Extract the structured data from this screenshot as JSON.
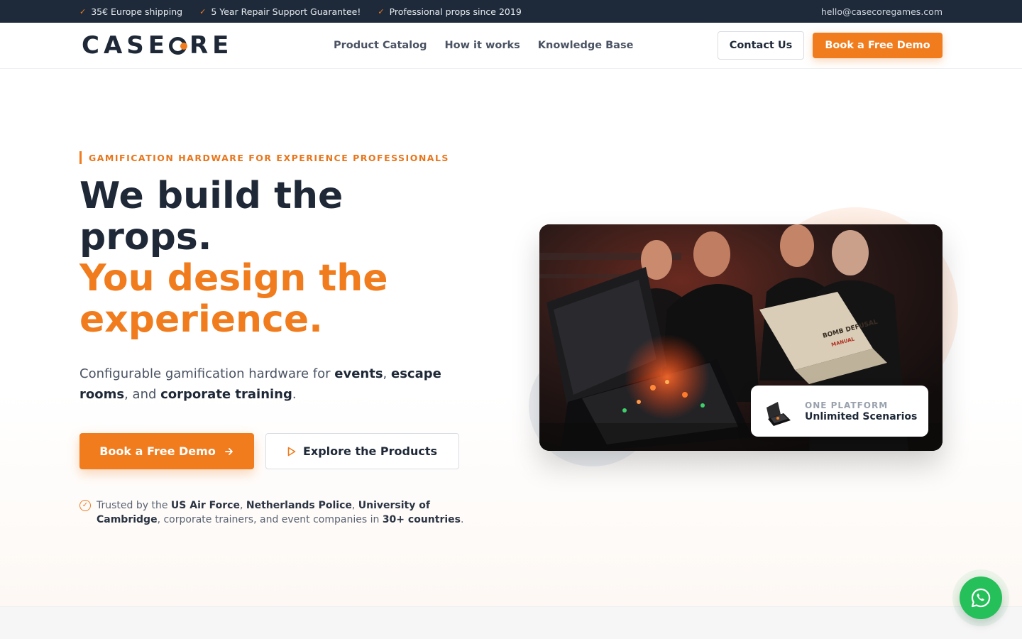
{
  "topbar": {
    "perks": [
      {
        "icon": "check-icon",
        "label": "35€ Europe shipping"
      },
      {
        "icon": "check-icon",
        "label": "5 Year Repair Support Guarantee!"
      },
      {
        "icon": "check-icon",
        "label": "Professional props since 2019"
      }
    ],
    "email": "hello@casecoregames.com"
  },
  "header": {
    "logo": {
      "before": "CASE",
      "after": "RE"
    },
    "nav": [
      "Product Catalog",
      "How it works",
      "Knowledge Base"
    ],
    "contact_label": "Contact Us",
    "demo_label": "Book a Free Demo"
  },
  "hero": {
    "eyebrow": "GAMIFICATION HARDWARE FOR EXPERIENCE PROFESSIONALS",
    "title_line1": "We build the props.",
    "title_line2": "You design the experience.",
    "lead": {
      "p1": "Configurable gamification hardware for ",
      "b1": "events",
      "p2": ", ",
      "b2": "escape rooms",
      "p3": ", and ",
      "b3": "corporate training",
      "p4": "."
    },
    "cta_primary": "Book a Free Demo",
    "cta_secondary": "Explore the Products",
    "trusted": {
      "p1": "Trusted by the ",
      "b1": "US Air Force",
      "p2": ", ",
      "b2": "Netherlands Police",
      "p3": ", ",
      "b3": "University of Cambridge",
      "p4": ", corporate trainers, and event companies in ",
      "b4": "30+ countries",
      "p5": "."
    },
    "image": {
      "manual_title": "BOMB DEFUSAL",
      "manual_subtitle": "MANUAL"
    },
    "badge": {
      "kicker": "ONE PLATFORM",
      "title": "Unlimited Scenarios"
    }
  },
  "colors": {
    "accent": "#f07c1e",
    "dark": "#1e2a3a",
    "whatsapp": "#25c05a"
  }
}
